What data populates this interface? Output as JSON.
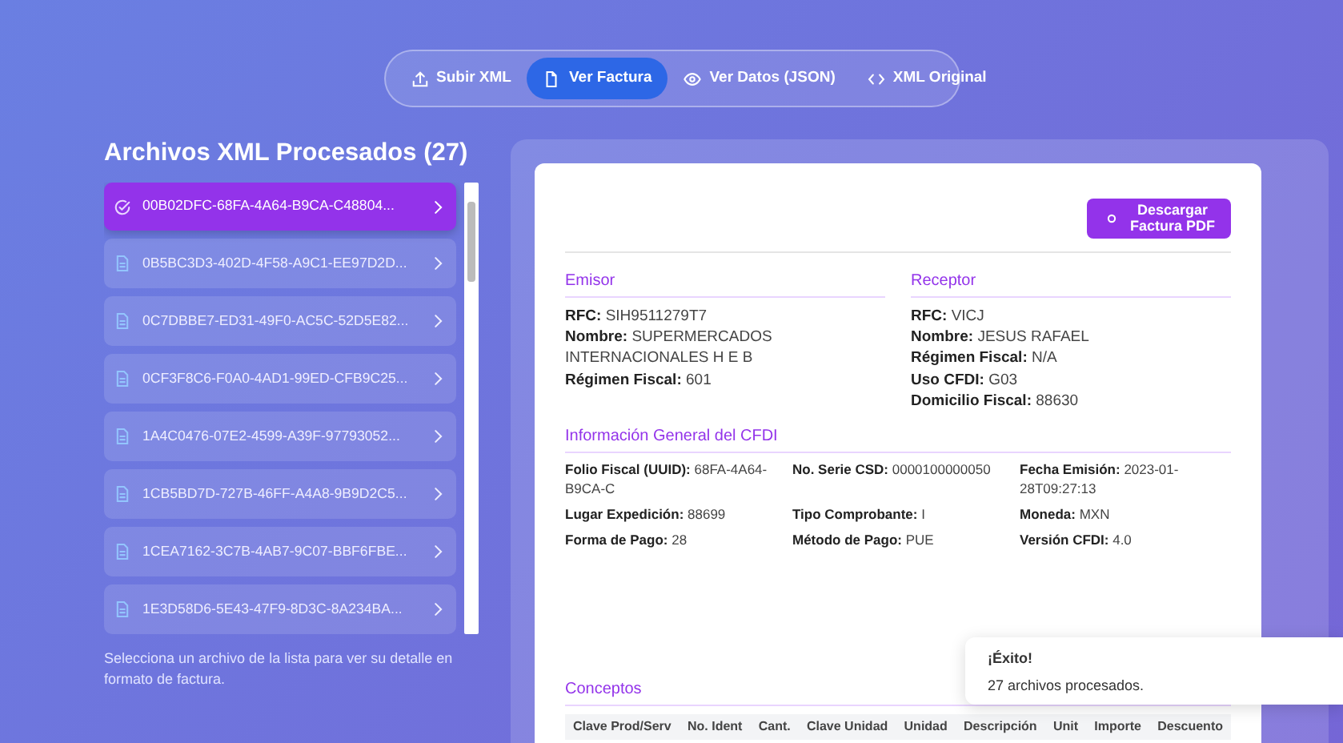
{
  "tabs": [
    {
      "label": "Subir XML",
      "selected": false
    },
    {
      "label": "Ver Factura",
      "selected": true
    },
    {
      "label": "Ver Datos (JSON)",
      "selected": false
    },
    {
      "label": "XML Original",
      "selected": false
    }
  ],
  "files": {
    "title": "Archivos XML Procesados (27)",
    "items": [
      {
        "name": "00B02DFC-68FA-4A64-B9CA-C48804...",
        "selected": true
      },
      {
        "name": "0B5BC3D3-402D-4F58-A9C1-EE97D2D...",
        "selected": false
      },
      {
        "name": "0C7DBBE7-ED31-49F0-AC5C-52D5E82...",
        "selected": false
      },
      {
        "name": "0CF3F8C6-F0A0-4AD1-99ED-CFB9C25...",
        "selected": false
      },
      {
        "name": "1A4C0476-07E2-4599-A39F-97793052...",
        "selected": false
      },
      {
        "name": "1CB5BD7D-727B-46FF-A4A8-9B9D2C5...",
        "selected": false
      },
      {
        "name": "1CEA7162-3C7B-4AB7-9C07-BBF6FBE...",
        "selected": false
      },
      {
        "name": "1E3D58D6-5E43-47F9-8D3C-8A234BA...",
        "selected": false
      }
    ],
    "hint": "Selecciona un archivo de la lista para ver su detalle en formato de factura."
  },
  "invoice": {
    "download_button": "Descargar Factura PDF",
    "emisor": {
      "title": "Emisor",
      "fields": [
        {
          "label": "RFC:",
          "value": "SIH9511279T7"
        },
        {
          "label": "Nombre:",
          "value": "SUPERMERCADOS INTERNACIONALES H E B"
        },
        {
          "label": "Régimen Fiscal:",
          "value": "601"
        }
      ]
    },
    "receptor": {
      "title": "Receptor",
      "fields": [
        {
          "label": "RFC:",
          "value": "VICJ"
        },
        {
          "label": "Nombre:",
          "value": "JESUS RAFAEL"
        },
        {
          "label": "Régimen Fiscal:",
          "value": "N/A"
        },
        {
          "label": "Uso CFDI:",
          "value": "G03"
        },
        {
          "label": "Domicilio Fiscal:",
          "value": "88630"
        }
      ]
    },
    "general": {
      "title": "Información General del CFDI",
      "fields": [
        {
          "label": "Folio Fiscal (UUID):",
          "value": "68FA-4A64-B9CA-C"
        },
        {
          "label": "No. Serie CSD:",
          "value": "0000100000050"
        },
        {
          "label": "Fecha Emisión:",
          "value": "2023-01-28T09:27:13"
        },
        {
          "label": "Lugar Expedición:",
          "value": "88699"
        },
        {
          "label": "Tipo Comprobante:",
          "value": "I"
        },
        {
          "label": "Moneda:",
          "value": "MXN"
        },
        {
          "label": "Forma de Pago:",
          "value": "28"
        },
        {
          "label": "Método de Pago:",
          "value": "PUE"
        },
        {
          "label": "Versión CFDI:",
          "value": "4.0"
        }
      ]
    },
    "conceptos": {
      "title": "Conceptos",
      "columns": [
        "Clave Prod/Serv",
        "No. Ident",
        "Cant.",
        "Clave Unidad",
        "Unidad",
        "Descripción",
        "Unit",
        "Importe",
        "Descuento"
      ]
    }
  },
  "toast": {
    "title": "¡Éxito!",
    "message": "27 archivos procesados."
  }
}
